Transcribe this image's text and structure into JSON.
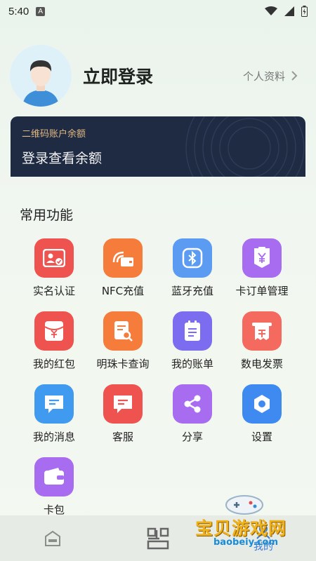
{
  "status_bar": {
    "time": "5:40",
    "notification_icon": "A"
  },
  "profile": {
    "login_text": "立即登录",
    "profile_link": "个人资料"
  },
  "balance_card": {
    "label": "二维码账户余额",
    "main_text": "登录查看余额"
  },
  "section": {
    "title": "常用功能"
  },
  "functions": [
    {
      "label": "实名认证",
      "icon": "id-card-icon",
      "color": "#ef5350"
    },
    {
      "label": "NFC充值",
      "icon": "nfc-card-icon",
      "color": "#f57c3a"
    },
    {
      "label": "蓝牙充值",
      "icon": "bluetooth-icon",
      "color": "#5b9bf2"
    },
    {
      "label": "卡订单管理",
      "icon": "yen-order-icon",
      "color": "#a86cf0"
    },
    {
      "label": "我的红包",
      "icon": "red-packet-icon",
      "color": "#ef5350"
    },
    {
      "label": "明珠卡查询",
      "icon": "card-search-icon",
      "color": "#f57c3a"
    },
    {
      "label": "我的账单",
      "icon": "bill-icon",
      "color": "#7b6cf0"
    },
    {
      "label": "数电发票",
      "icon": "invoice-icon",
      "color": "#f56a5e"
    },
    {
      "label": "我的消息",
      "icon": "message-icon",
      "color": "#3f9af0"
    },
    {
      "label": "客服",
      "icon": "customer-service-icon",
      "color": "#ef5350"
    },
    {
      "label": "分享",
      "icon": "share-icon",
      "color": "#a86cf0"
    },
    {
      "label": "设置",
      "icon": "settings-icon",
      "color": "#3f8af0"
    },
    {
      "label": "卡包",
      "icon": "wallet-icon",
      "color": "#a86cf0"
    }
  ],
  "bottom_nav": {
    "mine_label": "我的"
  },
  "watermark": {
    "title": "宝贝游戏网",
    "url": "baobeiy.com"
  }
}
